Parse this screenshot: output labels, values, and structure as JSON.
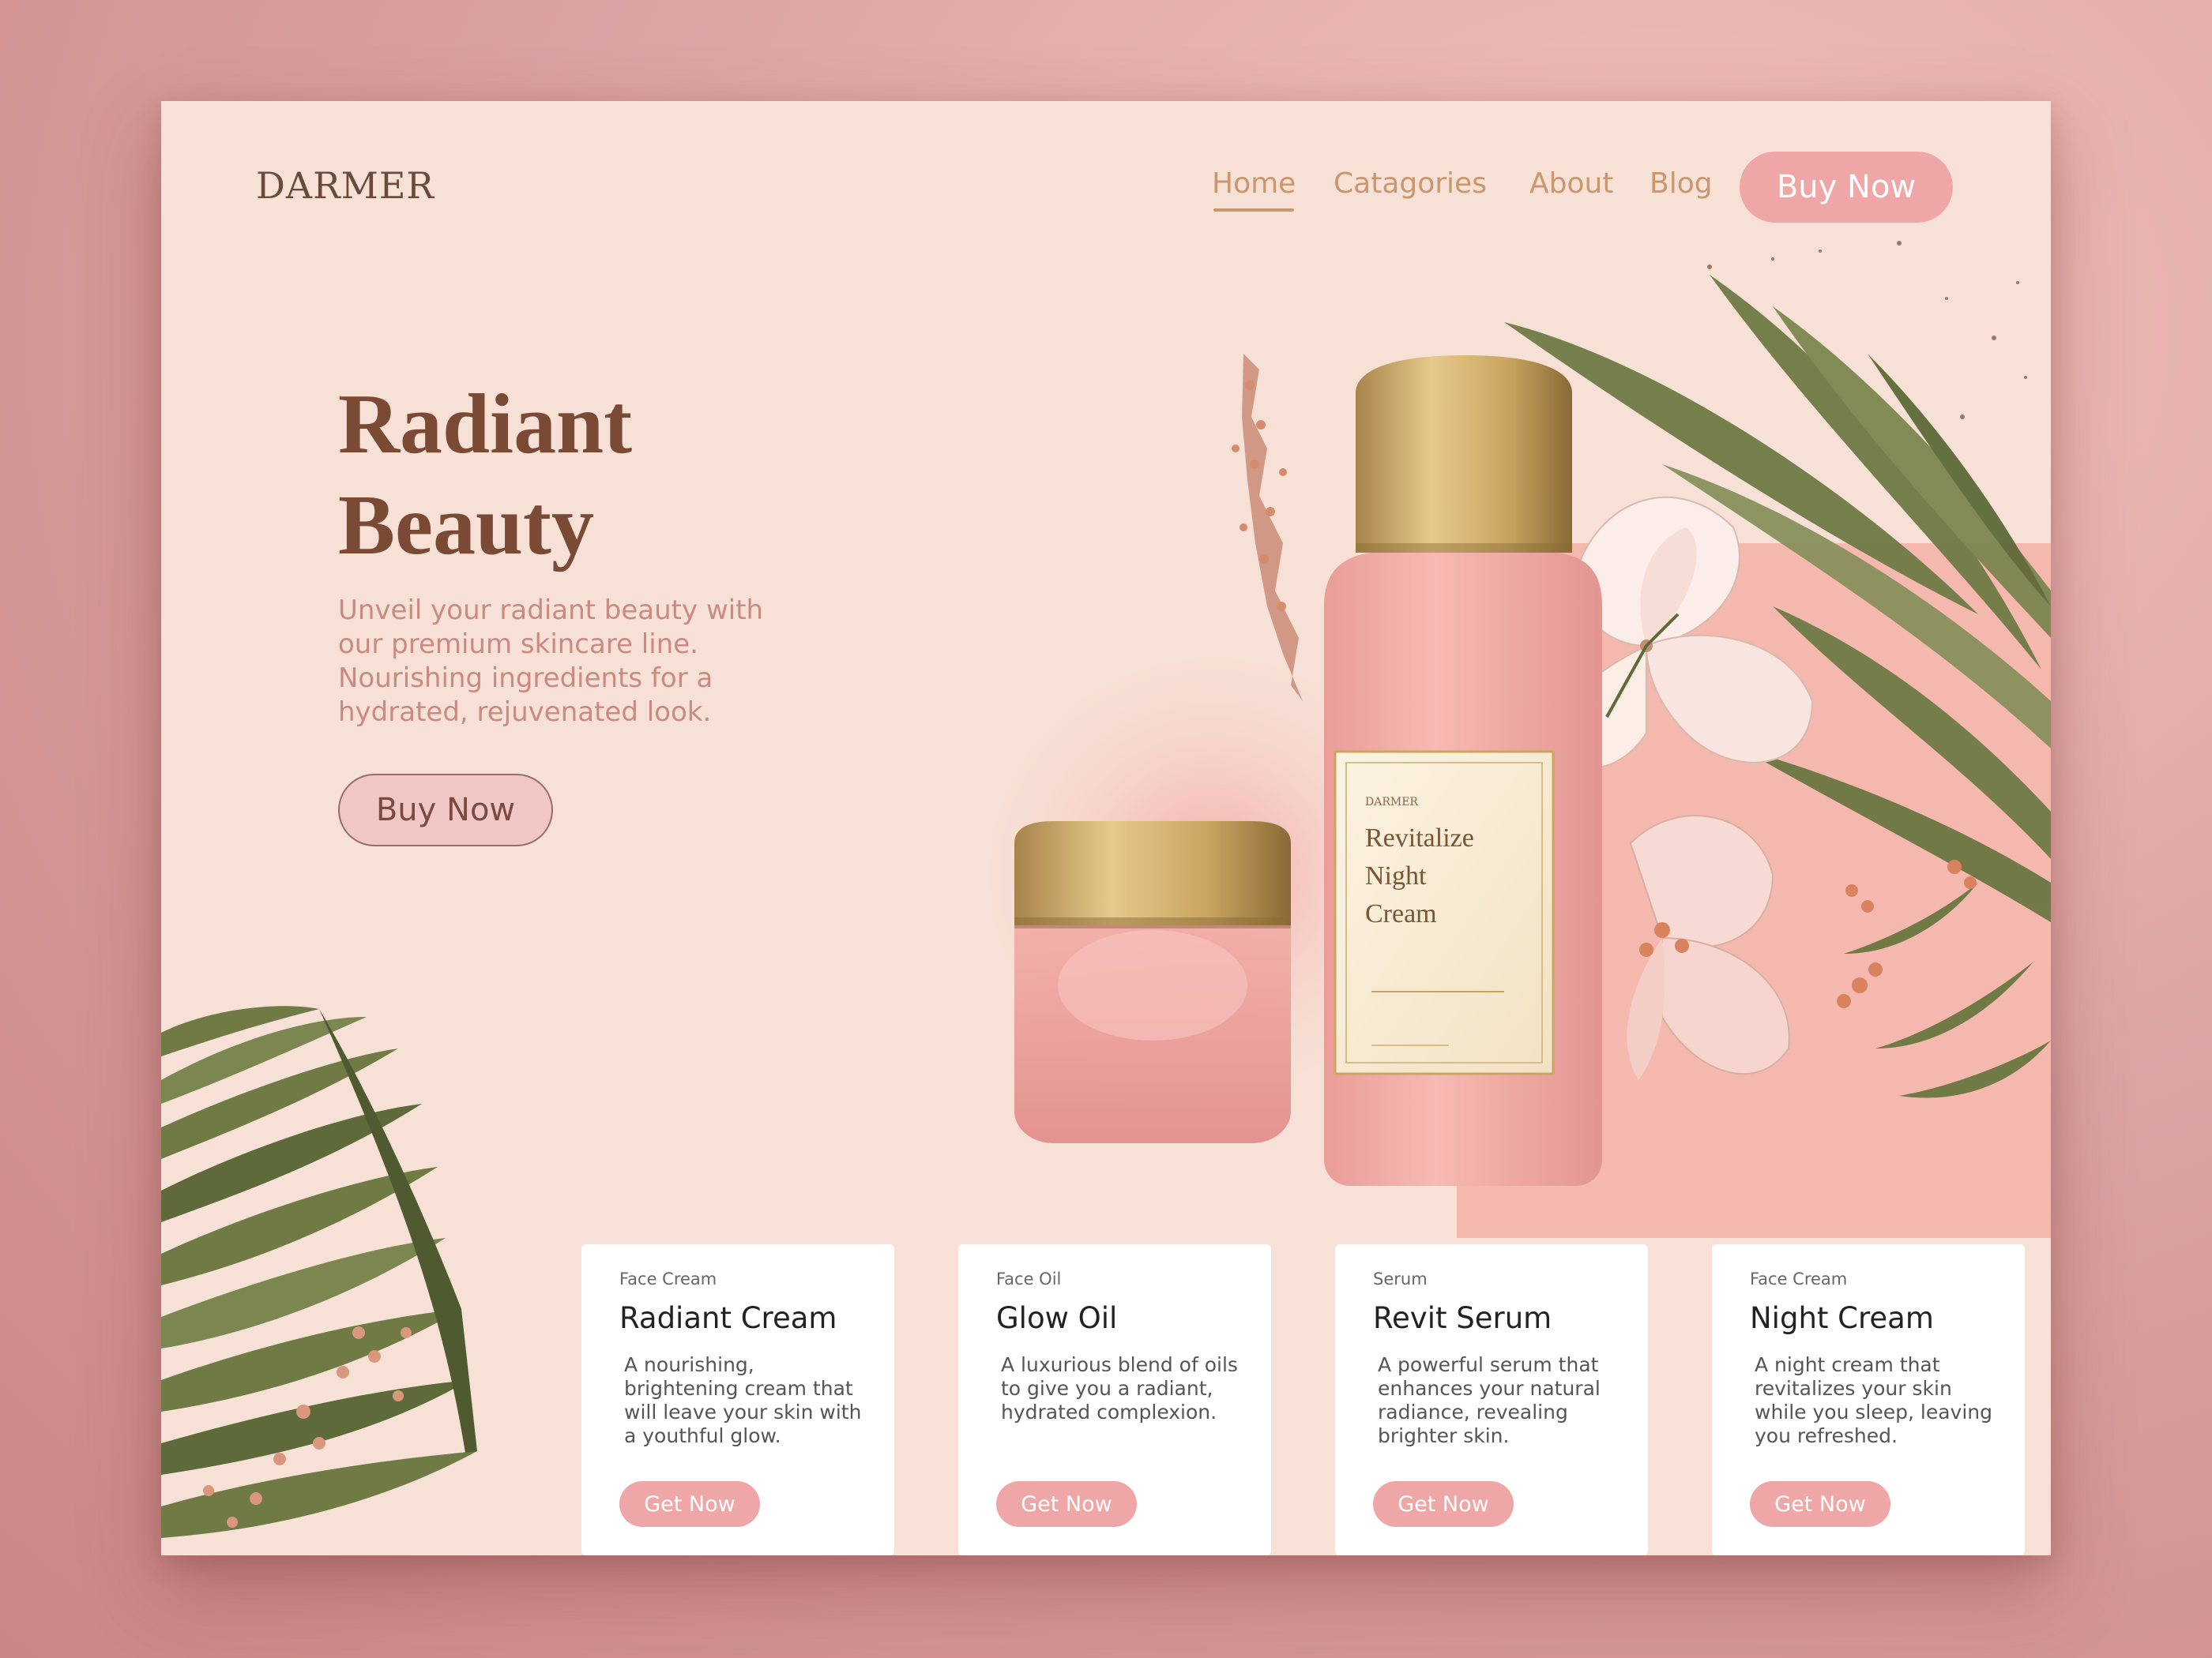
{
  "brand": {
    "logo": "DARMER"
  },
  "nav": {
    "items": [
      {
        "label": "Home",
        "active": true
      },
      {
        "label": "Catagories",
        "active": false
      },
      {
        "label": "About",
        "active": false
      },
      {
        "label": "Blog",
        "active": false
      }
    ],
    "cta_label": "Buy Now"
  },
  "hero": {
    "title_line1": "Radiant",
    "title_line2": "Beauty",
    "subtitle": "Unveil your radiant beauty with our premium skincare line. Nourishing ingredients for a hydrated, rejuvenated look.",
    "button_label": "Buy Now"
  },
  "product_label": {
    "brand": "DARMER",
    "line1": "Revitalize",
    "line2": "Night",
    "line3": "Cream"
  },
  "cards": [
    {
      "category": "Face Cream",
      "name": "Radiant Cream",
      "description": "A nourishing, brightening cream that will leave your skin with a youthful glow.",
      "button": "Get Now"
    },
    {
      "category": "Face Oil",
      "name": "Glow Oil",
      "description": "A luxurious blend of oils to give you a radiant, hydrated complexion.",
      "button": "Get Now"
    },
    {
      "category": "Serum",
      "name": "Revit Serum",
      "description": "A powerful serum that enhances your natural radiance, revealing brighter skin.",
      "button": "Get Now"
    },
    {
      "category": "Face Cream",
      "name": "Night Cream",
      "description": "A night cream that revitalizes your skin while you sleep, leaving you refreshed.",
      "button": "Get Now"
    }
  ],
  "colors": {
    "page_background": "#f7e1d6",
    "accent_pink": "#eea6a6",
    "title_brown": "#7a4a34",
    "nav_gold": "#c9966d",
    "leaf_green": "#6f7a45",
    "gold_cap": "#c9a560"
  }
}
